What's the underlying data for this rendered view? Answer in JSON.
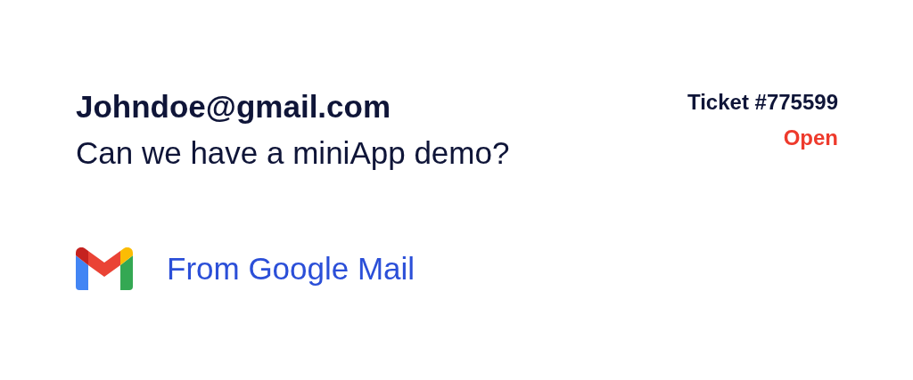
{
  "ticket": {
    "sender": "Johndoe@gmail.com",
    "subject": "Can we have a miniApp demo?",
    "number": "Ticket #775599",
    "status": {
      "label": "Open",
      "kind": "open"
    }
  },
  "source": {
    "label": "From Google Mail"
  }
}
